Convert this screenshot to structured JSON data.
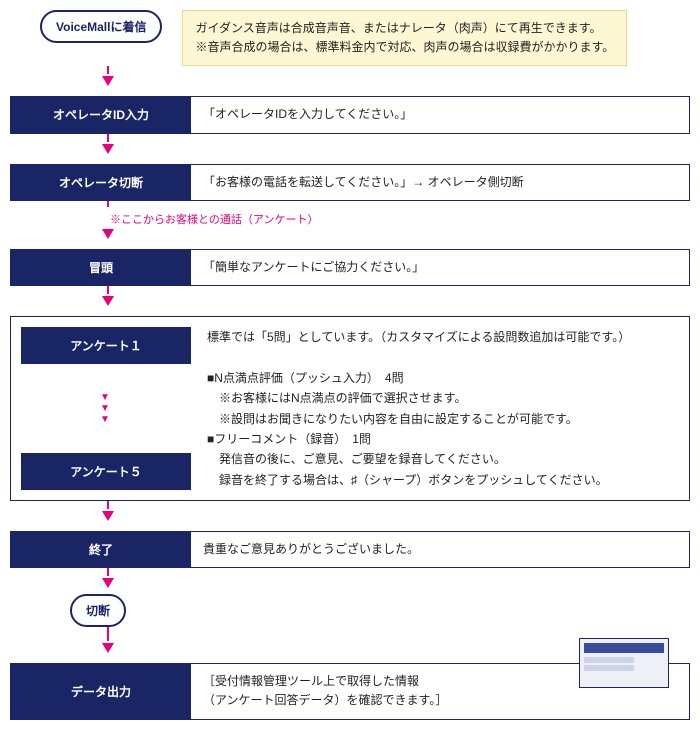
{
  "start": {
    "label": "VoiceMallに着信"
  },
  "guidance_note": {
    "line1": "ガイダンス音声は合成音声音、またはナレータ（肉声）にて再生できます。",
    "line2": "※音声合成の場合は、標準料金内で対応、肉声の場合は収録費がかかります。"
  },
  "steps": {
    "op_id": {
      "label": "オペレータID入力",
      "desc": "「オペレータIDを入力してください。」"
    },
    "op_cut": {
      "label": "オペレータ切断",
      "desc": "「お客様の電話を転送してください。」→ オペレータ側切断"
    },
    "intro": {
      "label": "冒頭",
      "desc": "「簡単なアンケートにご協力ください。」"
    },
    "end": {
      "label": "終了",
      "desc": "貴重なご意見ありがとうございました。"
    },
    "output": {
      "label": "データ出力",
      "desc1": "［受付情報管理ツール上で取得した情報",
      "desc2": "（アンケート回答データ）を確認できます。］"
    }
  },
  "transition_note": "※ここからお客様との通話（アンケート）",
  "survey": {
    "label_first": "アンケート１",
    "label_last": "アンケート５",
    "head": "標準では「5問」としています。（カスタマイズによる設問数追加は可能です。）",
    "b1_title": "■N点満点評価（プッシュ入力）　4問",
    "b1_l1": "　※お客様にはN点満点の評価で選択させます。",
    "b1_l2": "　※設問はお聞きになりたい内容を自由に設定することが可能です。",
    "b2_title": "■フリーコメント（録音）　1問",
    "b2_l1": "　発信音の後に、ご意見、ご要望を録音してください。",
    "b2_l2": "　録音を終了する場合は、♯（シャープ）ボタンをプッシュしてください。"
  },
  "disconnect": {
    "label": "切断"
  }
}
